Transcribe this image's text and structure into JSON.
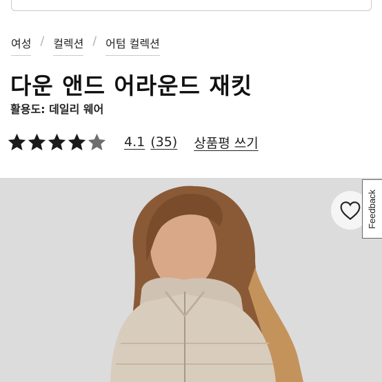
{
  "search": {
    "placeholder": ""
  },
  "breadcrumb": {
    "items": [
      "여성",
      "컬렉션",
      "어텀 컬렉션"
    ],
    "separator": "/"
  },
  "product": {
    "title": "다운 앤드 어라운드 재킷",
    "usage": "활용도: 데일리 웨어"
  },
  "rating": {
    "value": "4.1",
    "count": "(35)",
    "stars_filled": 4,
    "stars_total": 5,
    "write_review_label": "상품평 쓰기"
  },
  "image": {
    "alt": "model wearing light beige quilted hooded down jacket"
  },
  "feedback": {
    "label": "Feedback"
  },
  "colors": {
    "star": "#1a1a1a",
    "star_empty": "#6e6e6e",
    "hero_bg": "#dcdcdc",
    "jacket": "#d8ccbd"
  }
}
